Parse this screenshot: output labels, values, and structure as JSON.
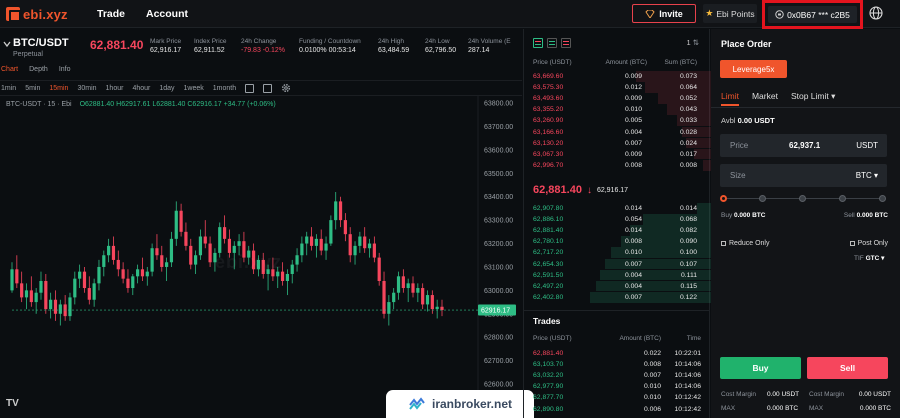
{
  "nav": {
    "logo": "ebi.xyz",
    "links": [
      "Trade",
      "Account"
    ],
    "invite": "Invite",
    "points": "Ebi Points",
    "wallet": "0x0B67 *** c2B5"
  },
  "ticker": {
    "pair": "BTC/USDT",
    "pair_sub": "Perpetual",
    "last_price": "62,881.40",
    "stats": [
      {
        "label": "Mark Price",
        "value": "62,916.17"
      },
      {
        "label": "Index Price",
        "value": "62,911.52"
      },
      {
        "label": "24h Change",
        "value": "-79.83  -0.12%"
      },
      {
        "label": "Funding / Countdown",
        "value": "0.0100%  00:53:14"
      },
      {
        "label": "24h High",
        "value": "63,484.59"
      },
      {
        "label": "24h Low",
        "value": "62,796.50"
      },
      {
        "label": "24h Volume (E",
        "value": "287.14"
      }
    ]
  },
  "chart_tabs": [
    "Chart",
    "Depth",
    "Info"
  ],
  "intervals": [
    "1min",
    "5min",
    "15min",
    "30min",
    "1hour",
    "4hour",
    "1day",
    "1week",
    "1month"
  ],
  "chart_legend": {
    "symbol": "BTC-USDT · 15 · Ebi",
    "ohlc": "O62881.40  H62917.61  L62881.40  C62916.17  +34.77 (+0.06%)"
  },
  "chart_watermark": "ebi.xyz",
  "tv_logo": "TV",
  "chart_data": {
    "type": "candlestick",
    "y_ticks": [
      "63800.00",
      "63700.00",
      "63600.00",
      "63500.00",
      "63400.00",
      "63300.00",
      "63200.00",
      "63100.00",
      "63000.00",
      "62900.00",
      "62800.00",
      "62700.00",
      "62600.00",
      "62500.00"
    ],
    "y_tick_values": [
      63800,
      63700,
      63600,
      63500,
      63400,
      63300,
      63200,
      63100,
      63000,
      62900,
      62800,
      62700,
      62600,
      62500
    ],
    "ylim": [
      62455,
      63830
    ],
    "current_price_label": "62916.17",
    "current_price": 62916,
    "candles": [
      [
        63000,
        63120,
        62990,
        63090
      ],
      [
        63090,
        63150,
        63010,
        63030
      ],
      [
        63030,
        63080,
        62950,
        62970
      ],
      [
        62970,
        63030,
        62920,
        63000
      ],
      [
        63000,
        63060,
        62930,
        62950
      ],
      [
        62950,
        63010,
        62900,
        62990
      ],
      [
        62990,
        63080,
        62960,
        63040
      ],
      [
        63040,
        63070,
        62900,
        62920
      ],
      [
        62920,
        62990,
        62880,
        62960
      ],
      [
        62960,
        63000,
        62870,
        62900
      ],
      [
        62900,
        62960,
        62850,
        62940
      ],
      [
        62940,
        62980,
        62870,
        62890
      ],
      [
        62890,
        62990,
        62870,
        62970
      ],
      [
        62970,
        63080,
        62940,
        63050
      ],
      [
        63050,
        63110,
        63010,
        63080
      ],
      [
        63080,
        63100,
        62990,
        63010
      ],
      [
        63010,
        63060,
        62940,
        62960
      ],
      [
        62960,
        63050,
        62930,
        63030
      ],
      [
        63030,
        63130,
        63000,
        63100
      ],
      [
        63100,
        63170,
        63060,
        63150
      ],
      [
        63150,
        63220,
        63120,
        63190
      ],
      [
        63190,
        63230,
        63110,
        63130
      ],
      [
        63130,
        63170,
        63060,
        63090
      ],
      [
        63090,
        63120,
        63030,
        63050
      ],
      [
        63050,
        63090,
        62990,
        63010
      ],
      [
        63010,
        63070,
        62980,
        63060
      ],
      [
        63060,
        63110,
        63030,
        63090
      ],
      [
        63090,
        63140,
        63040,
        63060
      ],
      [
        63060,
        63100,
        63020,
        63080
      ],
      [
        63080,
        63200,
        63060,
        63180
      ],
      [
        63180,
        63240,
        63130,
        63150
      ],
      [
        63150,
        63190,
        63080,
        63100
      ],
      [
        63100,
        63140,
        63040,
        63120
      ],
      [
        63120,
        63250,
        63100,
        63220
      ],
      [
        63220,
        63380,
        63190,
        63340
      ],
      [
        63340,
        63370,
        63230,
        63250
      ],
      [
        63250,
        63290,
        63170,
        63190
      ],
      [
        63190,
        63220,
        63090,
        63110
      ],
      [
        63110,
        63170,
        63070,
        63150
      ],
      [
        63150,
        63260,
        63130,
        63230
      ],
      [
        63230,
        63300,
        63180,
        63200
      ],
      [
        63200,
        63230,
        63100,
        63120
      ],
      [
        63120,
        63180,
        63080,
        63160
      ],
      [
        63160,
        63290,
        63140,
        63270
      ],
      [
        63270,
        63320,
        63200,
        63220
      ],
      [
        63220,
        63260,
        63140,
        63160
      ],
      [
        63160,
        63210,
        63090,
        63190
      ],
      [
        63190,
        63240,
        63150,
        63210
      ],
      [
        63210,
        63250,
        63120,
        63140
      ],
      [
        63140,
        63190,
        63110,
        63170
      ],
      [
        63170,
        63200,
        63070,
        63090
      ],
      [
        63090,
        63150,
        63060,
        63130
      ],
      [
        63130,
        63160,
        63050,
        63070
      ],
      [
        63070,
        63110,
        63000,
        63090
      ],
      [
        63090,
        63140,
        63040,
        63060
      ],
      [
        63060,
        63100,
        63010,
        63080
      ],
      [
        63080,
        63120,
        63020,
        63040
      ],
      [
        63040,
        63090,
        62980,
        63070
      ],
      [
        63070,
        63130,
        63030,
        63110
      ],
      [
        63110,
        63180,
        63080,
        63150
      ],
      [
        63150,
        63230,
        63120,
        63200
      ],
      [
        63200,
        63250,
        63150,
        63230
      ],
      [
        63230,
        63270,
        63170,
        63190
      ],
      [
        63190,
        63240,
        63140,
        63220
      ],
      [
        63220,
        63260,
        63150,
        63170
      ],
      [
        63170,
        63230,
        63130,
        63200
      ],
      [
        63200,
        63320,
        63190,
        63300
      ],
      [
        63300,
        63420,
        63260,
        63380
      ],
      [
        63380,
        63400,
        63270,
        63300
      ],
      [
        63300,
        63330,
        63210,
        63240
      ],
      [
        63240,
        63270,
        63120,
        63150
      ],
      [
        63150,
        63210,
        63110,
        63190
      ],
      [
        63190,
        63250,
        63160,
        63230
      ],
      [
        63230,
        63270,
        63160,
        63180
      ],
      [
        63180,
        63220,
        63140,
        63200
      ],
      [
        63200,
        63230,
        63120,
        63140
      ],
      [
        63140,
        63160,
        63020,
        63040
      ],
      [
        63040,
        63080,
        62880,
        62900
      ],
      [
        62900,
        62980,
        62850,
        62950
      ],
      [
        62950,
        63010,
        62920,
        62990
      ],
      [
        62990,
        63080,
        62960,
        63060
      ],
      [
        63060,
        63090,
        62990,
        63010
      ],
      [
        63010,
        63050,
        62950,
        63030
      ],
      [
        63030,
        63060,
        62970,
        62990
      ],
      [
        62990,
        63030,
        62950,
        63010
      ],
      [
        63010,
        63030,
        62920,
        62940
      ],
      [
        62940,
        63000,
        62910,
        62980
      ],
      [
        62980,
        63000,
        62900,
        62920
      ],
      [
        62920,
        62960,
        62880,
        62930
      ],
      [
        62930,
        62960,
        62890,
        62916
      ]
    ]
  },
  "orderbook": {
    "headers": [
      "Price (USDT)",
      "Amount (BTC)",
      "Sum (BTC)"
    ],
    "step": "1",
    "asks": [
      [
        "63,669.60",
        "0.009",
        "0.073",
        0.73
      ],
      [
        "63,575.30",
        "0.012",
        "0.064",
        0.64
      ],
      [
        "63,493.60",
        "0.009",
        "0.052",
        0.52
      ],
      [
        "63,355.20",
        "0.010",
        "0.043",
        0.43
      ],
      [
        "63,260.90",
        "0.005",
        "0.033",
        0.33
      ],
      [
        "63,166.60",
        "0.004",
        "0.028",
        0.28
      ],
      [
        "63,130.20",
        "0.007",
        "0.024",
        0.24
      ],
      [
        "63,067.30",
        "0.009",
        "0.017",
        0.17
      ],
      [
        "62,996.70",
        "0.008",
        "0.008",
        0.08
      ]
    ],
    "mid_price": "62,881.40",
    "mid_mark": "62,916.17",
    "bids": [
      [
        "62,907.80",
        "0.014",
        "0.014",
        0.11
      ],
      [
        "62,886.10",
        "0.054",
        "0.068",
        0.55
      ],
      [
        "62,881.40",
        "0.014",
        "0.082",
        0.66
      ],
      [
        "62,780.10",
        "0.008",
        "0.090",
        0.73
      ],
      [
        "62,717.20",
        "0.010",
        "0.100",
        0.81
      ],
      [
        "62,654.30",
        "0.007",
        "0.107",
        0.86
      ],
      [
        "62,591.50",
        "0.004",
        "0.111",
        0.9
      ],
      [
        "62,497.20",
        "0.004",
        "0.115",
        0.93
      ],
      [
        "62,402.80",
        "0.007",
        "0.122",
        0.98
      ]
    ]
  },
  "trades": {
    "title": "Trades",
    "headers": [
      "Price (USDT)",
      "Amount (BTC)",
      "Time"
    ],
    "rows": [
      [
        "62,881.40",
        "0.022",
        "10:22:01",
        "sell"
      ],
      [
        "63,103.70",
        "0.008",
        "10:14:06",
        "buy"
      ],
      [
        "63,032.20",
        "0.007",
        "10:14:06",
        "buy"
      ],
      [
        "62,977.90",
        "0.010",
        "10:14:06",
        "buy"
      ],
      [
        "62,877.70",
        "0.010",
        "10:12:42",
        "buy"
      ],
      [
        "62,890.80",
        "0.006",
        "10:12:42",
        "buy"
      ]
    ]
  },
  "order_panel": {
    "title": "Place Order",
    "leverage": "Leverage5x",
    "tabs": [
      "Limit",
      "Market",
      "Stop Limit ▾"
    ],
    "avbl_label": "Avbl",
    "avbl_value": "0.00 USDT",
    "price_label": "Price",
    "price_value": "62,937.1",
    "price_unit": "USDT",
    "size_label": "Size",
    "size_unit": "BTC ▾",
    "slider_percent": 0,
    "buy_amt_label": "Buy",
    "buy_amt_value": "0.000 BTC",
    "sell_amt_label": "Sell",
    "sell_amt_value": "0.000 BTC",
    "reduce_only": "Reduce Only",
    "post_only": "Post Only",
    "tif_label": "TIF",
    "tif_value": "GTC ▾",
    "buy": "Buy",
    "sell": "Sell",
    "cost_label": "Cost Margin",
    "cost_buy": "0.00 USDT",
    "cost_sell": "0.00 USDT",
    "max_label": "MAX",
    "max_buy": "0.000 BTC",
    "max_sell": "0.000 BTC"
  },
  "banner": {
    "text": "iranbroker.net"
  },
  "colors": {
    "accent": "#f0552c",
    "up": "#2ebd85",
    "down": "#f6465d",
    "highlight_box": "#e4141e"
  }
}
